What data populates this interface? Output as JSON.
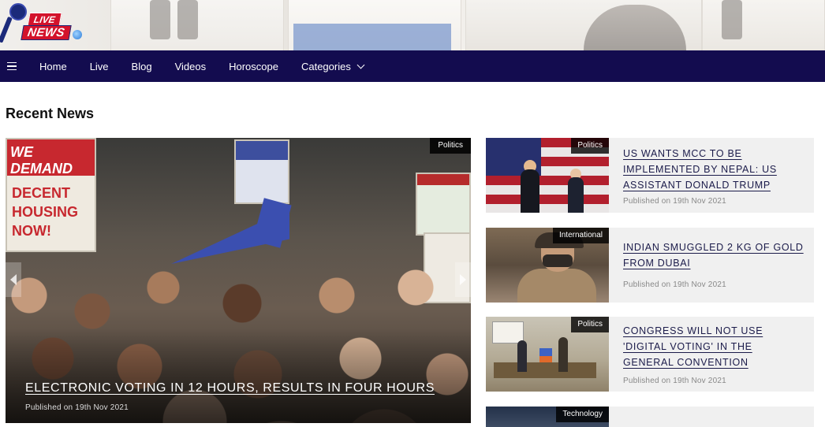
{
  "header": {
    "logo": {
      "tag_top": "LIVE",
      "tag_bottom": "NEWS"
    }
  },
  "nav": {
    "items": [
      {
        "label": "Home"
      },
      {
        "label": "Live"
      },
      {
        "label": "Blog"
      },
      {
        "label": "Videos"
      },
      {
        "label": "Horoscope"
      },
      {
        "label": "Categories"
      }
    ]
  },
  "main": {
    "section_title": "Recent News",
    "featured": {
      "category": "Politics",
      "headline": "ELECTRONIC VOTING IN 12 HOURS, RESULTS IN FOUR HOURS",
      "published": "Published on 19th Nov 2021",
      "sign_texts": {
        "we_demand": "WE DEMAND",
        "decent_housing": "DECENT HOUSING NOW!"
      }
    },
    "list": [
      {
        "category": "Politics",
        "title": "US WANTS MCC TO BE IMPLEMENTED BY NEPAL: US ASSISTANT DONALD TRUMP",
        "published": "Published on 19th Nov 2021"
      },
      {
        "category": "International",
        "title": "INDIAN SMUGGLED 2 KG OF GOLD FROM DUBAI",
        "published": "Published on 19th Nov 2021"
      },
      {
        "category": "Politics",
        "title": "CONGRESS WILL NOT USE 'DIGITAL VOTING' IN THE GENERAL CONVENTION",
        "published": "Published on 19th Nov 2021"
      },
      {
        "category": "Technology",
        "title": "",
        "published": ""
      }
    ]
  },
  "colors": {
    "nav_bg": "#130c4f",
    "logo_red": "#d3122b",
    "title_link": "#1b1b4a"
  },
  "icons": {
    "menu": "hamburger-icon",
    "dropdown": "chevron-down-icon",
    "prev": "arrow-left-icon",
    "next": "arrow-right-icon"
  }
}
